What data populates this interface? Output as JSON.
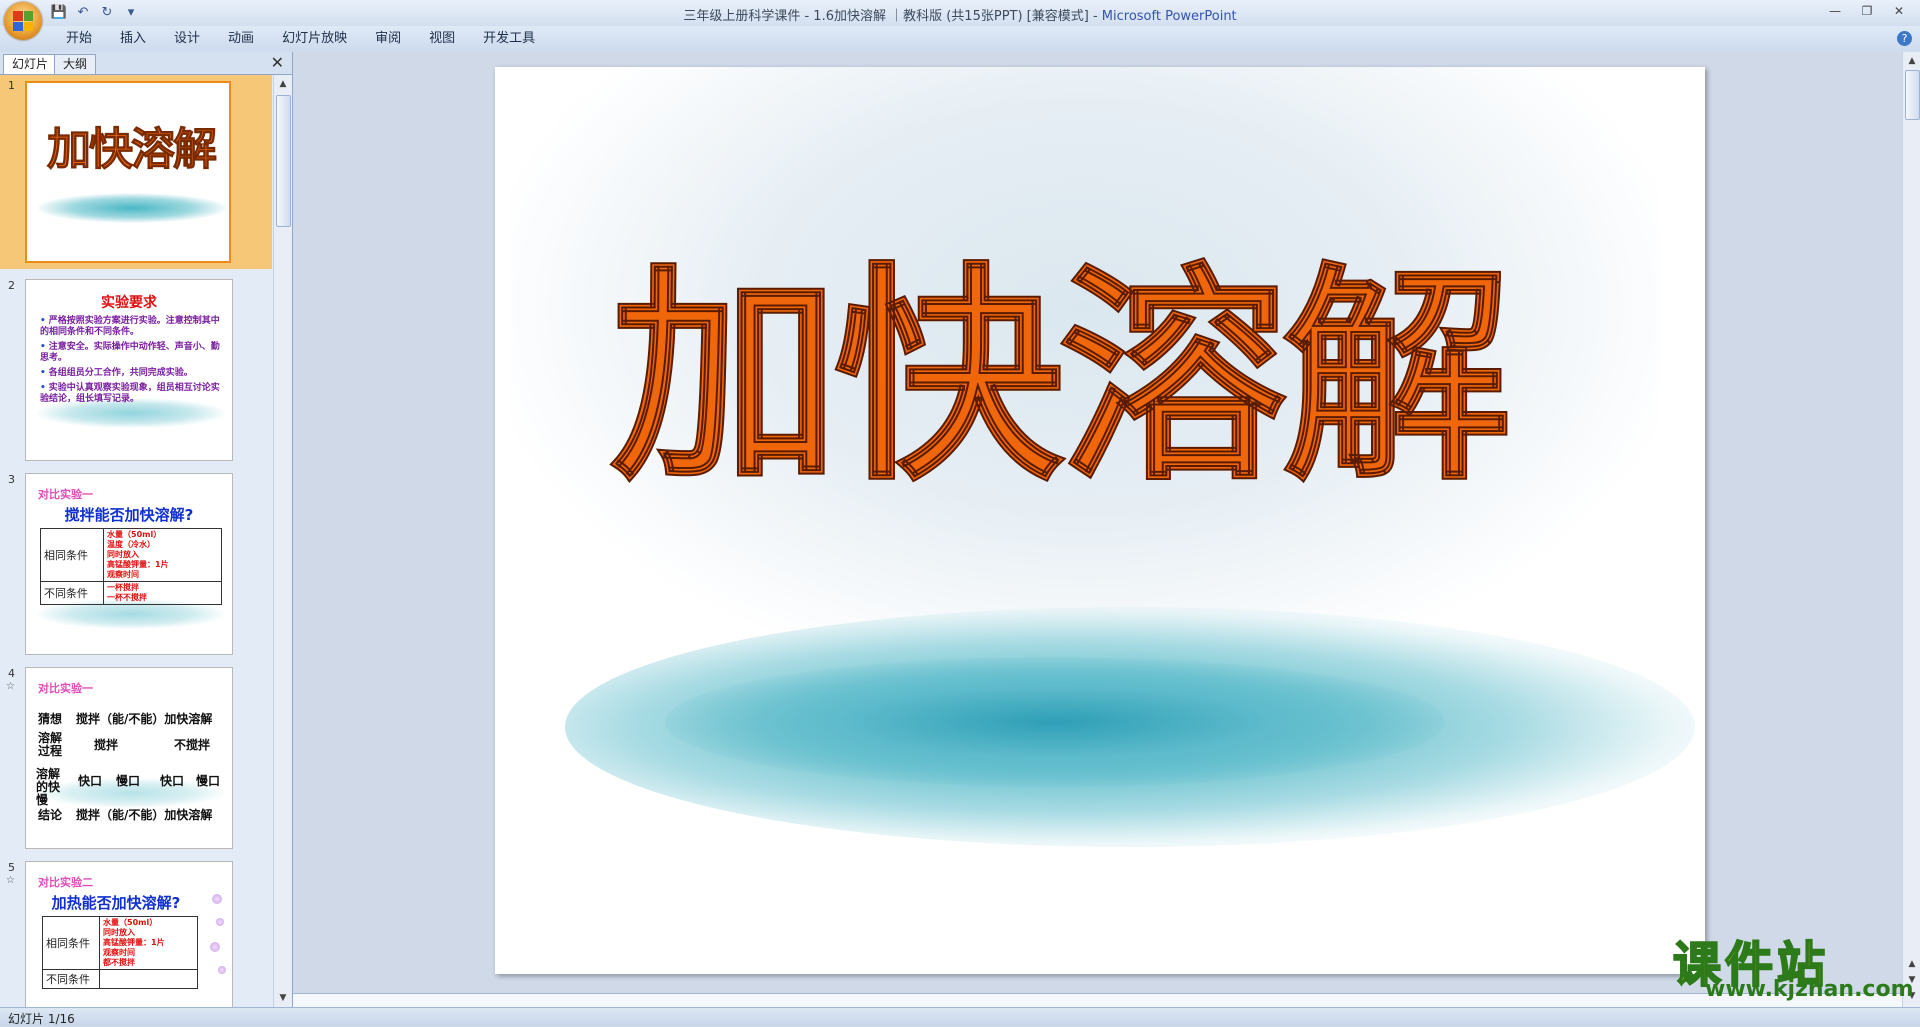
{
  "window": {
    "title_doc": "三年级上册科学课件 - 1.6加快溶解 ｜教科版 (共15张PPT) [兼容模式] - ",
    "title_app": "Microsoft PowerPoint"
  },
  "ribbon": {
    "tabs": [
      "开始",
      "插入",
      "设计",
      "动画",
      "幻灯片放映",
      "审阅",
      "视图",
      "开发工具"
    ]
  },
  "panel": {
    "tab_slides": "幻灯片",
    "tab_outline": "大纲"
  },
  "thumbnails": {
    "s1": {
      "num": "1",
      "title": "加快溶解"
    },
    "s2": {
      "num": "2",
      "title": "实验要求",
      "items": [
        "严格按照实验方案进行实验。注意控制其中的相同条件和不同条件。",
        "注意安全。实际操作中动作轻、声音小、勤思考。",
        "各组组员分工合作，共同完成实验。",
        "实验中认真观察实验现象，组员相互讨论实验结论，组长填写记录。"
      ]
    },
    "s3": {
      "num": "3",
      "label": "对比实验一",
      "heading": "搅拌能否加快溶解?",
      "same_label": "相同条件",
      "same_items": [
        "水量（50ml）",
        "温度（冷水）",
        "同时放入",
        "高锰酸钾量：1片",
        "观察时间"
      ],
      "diff_label": "不同条件",
      "diff_items": [
        "一杯搅拌",
        "一杯不搅拌"
      ]
    },
    "s4": {
      "num": "4",
      "label": "对比实验一",
      "guess_label": "猜想",
      "guess_text": "搅拌（能/不能）加快溶解",
      "process_label": "溶解过程",
      "col_a": "搅拌",
      "col_b": "不搅拌",
      "speed_label": "溶解的快慢",
      "fast1": "快口",
      "slow1": "慢口",
      "fast2": "快口",
      "slow2": "慢口",
      "conclusion_label": "结论",
      "conclusion_text": "搅拌（能/不能）加快溶解"
    },
    "s5": {
      "num": "5",
      "label": "对比实验二",
      "heading": "加热能否加快溶解?",
      "same_label": "相同条件",
      "same_items": [
        "水量（50ml）",
        "同时放入",
        "高锰酸钾量：1片",
        "观察时间",
        "都不搅拌"
      ],
      "diff_label": "不同条件"
    }
  },
  "slide": {
    "title": "加快溶解"
  },
  "status": {
    "slide_indicator": "幻灯片 1/16"
  },
  "watermark": {
    "text": "课件站",
    "url": "www.kjzhan.com"
  },
  "colors": {
    "title_orange": "#f0660a",
    "mist_teal": "#3aa8bf",
    "selection": "#f6c776"
  }
}
